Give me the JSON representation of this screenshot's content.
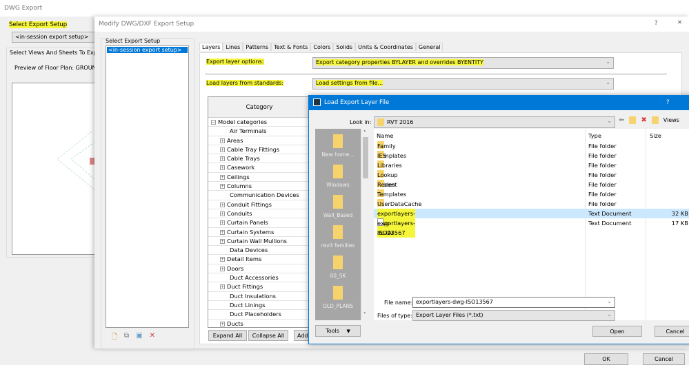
{
  "main_window": {
    "title": "DWG Export",
    "select_export_setup_label": "Select Export Setup",
    "setup_value": "<in-session export setup>",
    "select_views_label": "Select Views And Sheets To Export",
    "preview_label": "Preview of Floor Plan: GROUND F",
    "ok_label": "OK",
    "cancel_label": "Cancel"
  },
  "modify_dialog": {
    "title": "Modify DWG/DXF Export Setup",
    "help": "?",
    "close": "✕",
    "setup_group_label": "Select Export Setup",
    "setups": [
      "<in-session export setup>"
    ],
    "tabs": [
      "Layers",
      "Lines",
      "Patterns",
      "Text & Fonts",
      "Colors",
      "Solids",
      "Units & Coordinates",
      "General"
    ],
    "active_tab": "Layers",
    "export_layer_options_label": "Export layer options:",
    "export_layer_options_value": "Export category properties BYLAYER and overrides BYENTITY",
    "load_layers_label": "Load layers from standards:",
    "load_layers_value": "Load settings from file...",
    "tree_header": "Category",
    "tree_root": "Model categories",
    "tree_items": [
      {
        "label": "Air Terminals",
        "expandable": false
      },
      {
        "label": "Areas",
        "expandable": true
      },
      {
        "label": "Cable Tray Fittings",
        "expandable": true
      },
      {
        "label": "Cable Trays",
        "expandable": true
      },
      {
        "label": "Casework",
        "expandable": true
      },
      {
        "label": "Ceilings",
        "expandable": true
      },
      {
        "label": "Columns",
        "expandable": true
      },
      {
        "label": "Communication Devices",
        "expandable": false
      },
      {
        "label": "Conduit Fittings",
        "expandable": true
      },
      {
        "label": "Conduits",
        "expandable": true
      },
      {
        "label": "Curtain Panels",
        "expandable": true
      },
      {
        "label": "Curtain Systems",
        "expandable": true
      },
      {
        "label": "Curtain Wall Mullions",
        "expandable": true
      },
      {
        "label": "Data Devices",
        "expandable": false
      },
      {
        "label": "Detail Items",
        "expandable": true
      },
      {
        "label": "Doors",
        "expandable": true
      },
      {
        "label": "Duct Accessories",
        "expandable": false
      },
      {
        "label": "Duct Fittings",
        "expandable": true
      },
      {
        "label": "Duct Insulations",
        "expandable": false
      },
      {
        "label": "Duct Linings",
        "expandable": false
      },
      {
        "label": "Duct Placeholders",
        "expandable": false
      },
      {
        "label": "Ducts",
        "expandable": true
      }
    ],
    "expand_all": "Expand All",
    "collapse_all": "Collapse All",
    "add": "Add"
  },
  "load_dialog": {
    "title": "Load Export Layer File",
    "help": "?",
    "look_in_label": "Look in:",
    "look_in_value": "RVT 2016",
    "views_label": "Views",
    "places": [
      "New home...",
      "Windows",
      "Wall_Based",
      "revit families",
      "00_SK",
      "OLD_PLANS"
    ],
    "columns": {
      "name": "Name",
      "type": "Type",
      "size": "Size"
    },
    "files": [
      {
        "name": "Family Templates",
        "type": "File folder",
        "size": "",
        "kind": "folder"
      },
      {
        "name": "IES",
        "type": "File folder",
        "size": "",
        "kind": "folder"
      },
      {
        "name": "Libraries",
        "type": "File folder",
        "size": "",
        "kind": "folder"
      },
      {
        "name": "Lookup Tables",
        "type": "File folder",
        "size": "",
        "kind": "folder"
      },
      {
        "name": "Recent",
        "type": "File folder",
        "size": "",
        "kind": "folder"
      },
      {
        "name": "Templates",
        "type": "File folder",
        "size": "",
        "kind": "folder"
      },
      {
        "name": "UserDataCache",
        "type": "File folder",
        "size": "",
        "kind": "folder"
      },
      {
        "name": "exportlayers-dwg-ISO13567",
        "type": "Text Document",
        "size": "32 KB",
        "kind": "doc"
      },
      {
        "name": "exportlayers-ifc-IAI",
        "type": "Text Document",
        "size": "17 KB",
        "kind": "doc"
      }
    ],
    "selected_file": "exportlayers-dwg-ISO13567",
    "file_name_label": "File name:",
    "file_name_value": "exportlayers-dwg-ISO13567",
    "file_type_label": "Files of type:",
    "file_type_value": "Export Layer Files (*.txt)",
    "tools_label": "Tools",
    "open_label": "Open",
    "cancel_label": "Cancel"
  },
  "colors": {
    "title_bar": "#0078d7",
    "selection": "#cce8ff",
    "highlight": "#f5f53a"
  }
}
